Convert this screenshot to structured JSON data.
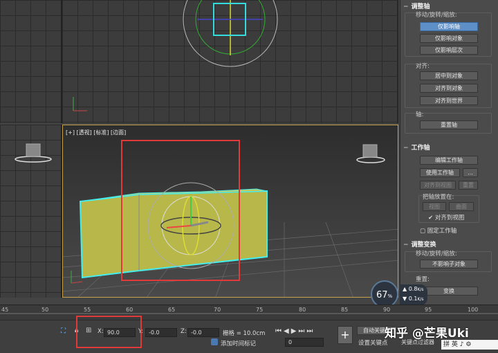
{
  "viewports": {
    "perspective_label": "[+] [透视] [标准] [边面]"
  },
  "panel": {
    "adjust_pivot": {
      "title": "调整轴",
      "move_group": "移动/旋转/缩放:",
      "affect_pivot": "仅影响轴",
      "affect_object": "仅影响对象",
      "affect_hierarchy": "仅影响层次",
      "align_group": "对齐:",
      "center_to_object": "居中到对象",
      "align_to_object": "对齐到对象",
      "align_to_world": "对齐到世界",
      "pivot_group": "轴:",
      "reset_pivot": "重置轴"
    },
    "working_pivot": {
      "title": "工作轴",
      "edit_working_pivot": "编辑工作轴",
      "use_working_pivot": "使用工作轴",
      "more": "...",
      "align_to_view": "对齐到视图",
      "reset": "重置",
      "place_pivot_to": "把轴放置在:",
      "view": "视图",
      "surface": "曲面",
      "align_to_view_check": "对齐到视图",
      "lock_working_pivot": "固定工作轴"
    },
    "adjust_transform": {
      "title": "调整变换",
      "move_group": "移动/旋转/缩放:",
      "dont_affect_children": "不影响子对象",
      "reset_group": "重置:",
      "transform": "变换"
    }
  },
  "perf_widget": {
    "percent": "67",
    "percent_unit": "%",
    "up_rate": "0.8",
    "down_rate": "0.1",
    "rate_unit": "K/s"
  },
  "timeline": {
    "ticks": [
      "45",
      "50",
      "55",
      "60",
      "65",
      "70",
      "75",
      "80",
      "85",
      "90",
      "95",
      "100"
    ]
  },
  "status": {
    "x_label": "X:",
    "x_value": "90.0",
    "y_label": "Y:",
    "y_value": "-0.0",
    "z_label": "Z:",
    "z_value": "-0.0",
    "grid_text": "栅格 = 10.0cm",
    "add_time_tag": "添加时间标记",
    "auto_key": "自动关键点",
    "set_key": "设置关键点",
    "key_filters": "关键点过滤器",
    "frame_value": "0",
    "ime": "拼 英 ♪ ⚙",
    "watermark": "知乎 @芒果Uki"
  }
}
